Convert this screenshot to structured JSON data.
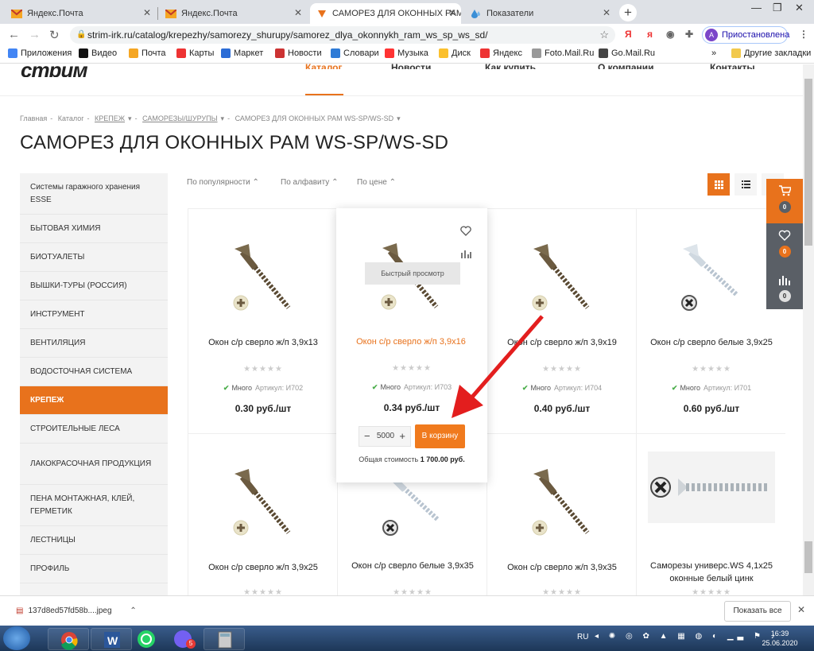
{
  "browser": {
    "tabs": [
      {
        "label": "Яндекс.Почта",
        "icon": "mail-icon",
        "active": false
      },
      {
        "label": "Яндекс.Почта",
        "icon": "mail-icon",
        "active": false
      },
      {
        "label": "САМОРЕЗ ДЛЯ ОКОННЫХ РАМ",
        "icon": "site-favicon",
        "active": true
      },
      {
        "label": "Показатели",
        "icon": "drop-icon",
        "active": false
      }
    ],
    "url": "strim-irk.ru/catalog/krepezhy/samorezy_shurupy/samorez_dlya_okonnykh_ram_ws_sp_ws_sd/",
    "profile_label": "Приостановлена",
    "profile_initial": "A",
    "bookmarks": [
      "Приложения",
      "Видео",
      "Почта",
      "Карты",
      "Маркет",
      "Новости",
      "Словари",
      "Музыка",
      "Диск",
      "Яндекс",
      "Foto.Mail.Ru",
      "Go.Mail.Ru"
    ],
    "other_bookmarks": "Другие закладки",
    "more_bookmarks": "»"
  },
  "site": {
    "logo": "стрим",
    "menu": [
      "Каталог",
      "Новости",
      "Как купить",
      "О компании",
      "Контакты"
    ]
  },
  "breadcrumb": [
    "Главная",
    "Каталог",
    "КРЕПЕЖ",
    "САМОРЕЗЫ/ШУРУПЫ",
    "САМОРЕЗ ДЛЯ ОКОННЫХ РАМ WS-SP/WS-SD"
  ],
  "page_title": "САМОРЕЗ ДЛЯ ОКОННЫХ РАМ WS-SP/WS-SD",
  "sidebar": [
    "Системы гаражного хранения ESSE",
    "БЫТОВАЯ ХИМИЯ",
    "БИОТУАЛЕТЫ",
    "ВЫШКИ-ТУРЫ (РОССИЯ)",
    "ИНСТРУМЕНТ",
    "ВЕНТИЛЯЦИЯ",
    "ВОДОСТОЧНАЯ СИСТЕМА",
    "КРЕПЕЖ",
    "СТРОИТЕЛЬНЫЕ ЛЕСА",
    "ЛАКОКРАСОЧНАЯ ПРОДУКЦИЯ",
    "ПЕНА МОНТАЖНАЯ, КЛЕЙ, ГЕРМЕТИК",
    "ЛЕСТНИЦЫ",
    "ПРОФИЛЬ"
  ],
  "sidebar_active_index": 7,
  "sorting": [
    "По популярности",
    "По алфавиту",
    "По цене"
  ],
  "floating_panel": {
    "cart": "0",
    "favorites": "0",
    "compare": "0"
  },
  "products": [
    {
      "name": "Окон с/р сверло ж/п 3,9х13",
      "stock": "Много",
      "article_label": "Артикул:",
      "article": "И702",
      "price": "0.30 руб./шт",
      "head": "phillips"
    },
    {
      "name": "Окон с/р сверло ж/п 3,9х16",
      "stock": "Много",
      "article_label": "Артикул:",
      "article": "И703",
      "price": "0.34 руб./шт",
      "head": "phillips"
    },
    {
      "name": "Окон с/р сверло ж/п 3,9х19",
      "stock": "Много",
      "article_label": "Артикул:",
      "article": "И704",
      "price": "0.40 руб./шт",
      "head": "phillips"
    },
    {
      "name": "Окон с/р сверло белые 3,9х25",
      "stock": "Много",
      "article_label": "Артикул:",
      "article": "И701",
      "price": "0.60 руб./шт",
      "head": "white"
    },
    {
      "name": "Окон с/р сверло ж/п 3,9х25",
      "head": "phillips"
    },
    {
      "name": "Окон с/р сверло белые 3,9х35",
      "head": "white"
    },
    {
      "name": "Окон с/р сверло ж/п 3,9х35",
      "head": "phillips"
    },
    {
      "name": "Саморезы универс.WS 4,1х25 оконные белый цинк",
      "head": "long"
    }
  ],
  "hover": {
    "quick_view": "Быстрый просмотр",
    "qty": "5000",
    "add_to_cart": "В корзину",
    "total_label": "Общая стоимость",
    "total_value": "1 700.00 руб."
  },
  "download": {
    "file": "137d8ed57fd58b....jpeg",
    "show_all": "Показать все"
  },
  "taskbar": {
    "lang": "RU",
    "time": "16:39",
    "date": "25.06.2020",
    "viber_badge": "5"
  },
  "colors": {
    "accent": "#e8721c",
    "title_link": "#e8721c",
    "stock_check": "#4cae4c",
    "panel_dark": "#5a5f66"
  }
}
